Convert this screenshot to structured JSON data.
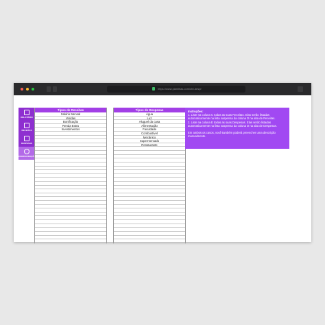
{
  "browser": {
    "url": "https://www.planilhas.com/ctrl-despr"
  },
  "sidebar": {
    "items": [
      {
        "label": "RELATÓRIO",
        "icon": "report-icon"
      },
      {
        "label": "RECEITAS",
        "icon": "income-icon"
      },
      {
        "label": "DESPESAS",
        "icon": "expenses-icon"
      },
      {
        "label": "CONFIGURAÇÕES",
        "icon": "gear-icon"
      }
    ]
  },
  "receitas": {
    "header": "Tipos de Receitas",
    "rows": [
      "Salário Mensal",
      "Vendas",
      "Bonificação",
      "Renda Extra",
      "Investimentos"
    ]
  },
  "despesas": {
    "header": "Tipos de Despesas",
    "rows": [
      "Água",
      "Luz",
      "Aluguel da casa",
      "Alimentação",
      "Faculdade",
      "Combustível",
      "Mecânico",
      "Supermercado",
      "Restaurante"
    ]
  },
  "instructions": {
    "title": "Instruções:",
    "line1": "1. Liste na coluna C todas as suas Receitas. Elas serão listadas automaticamente na lista suspensa da coluna D na aba de Receitas.",
    "line2": "2. Liste na coluna E todas as suas Despesas. Elas serão listadas automaticamente na lista suspensa da coluna D na aba de Despesas.",
    "line3": "Em ambos os casos, você também poderá preencher uma descrição manualmente."
  }
}
